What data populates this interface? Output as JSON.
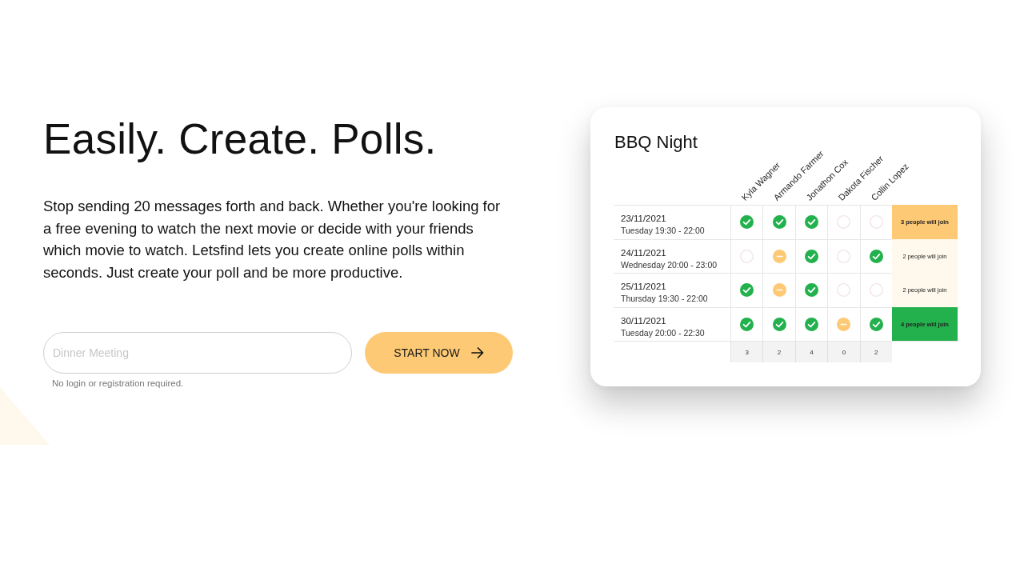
{
  "hero": {
    "title": "Easily. Create. Polls.",
    "description": "Stop sending 20 messages forth and back. Whether you're looking for a free evening to watch the next movie or decide with your friends which movie to watch. Letsfind lets you create online polls within seconds. Just create your poll and be more productive.",
    "input": {
      "placeholder": "Dinner Meeting"
    },
    "button": "START NOW",
    "hint": "No login or registration required."
  },
  "poll_card": {
    "title": "BBQ Night",
    "participants": [
      "Kyla Wagner",
      "Armando Farmer",
      "Jonathon Cox",
      "Dakota Fischer",
      "Collin Lopez"
    ],
    "rows": [
      {
        "date": "23/11/2021",
        "time": "Tuesday 19:30 - 22:00",
        "votes": [
          {
            "kind": "yes"
          },
          {
            "kind": "yes"
          },
          {
            "kind": "yes"
          },
          {
            "kind": "none"
          },
          {
            "kind": "none"
          }
        ],
        "result": "3 people will join",
        "color": "#fdc974",
        "emphasized": true
      },
      {
        "date": "24/11/2021",
        "time": "Wednesday 20:00 - 23:00",
        "votes": [
          {
            "kind": "none"
          },
          {
            "kind": "maybe"
          },
          {
            "kind": "yes"
          },
          {
            "kind": "none"
          },
          {
            "kind": "yes"
          }
        ],
        "result": "2 people will join",
        "color": "#fef9ec",
        "emphasized": false
      },
      {
        "date": "25/11/2021",
        "time": "Thursday 19:30 - 22:00",
        "votes": [
          {
            "kind": "yes"
          },
          {
            "kind": "maybe"
          },
          {
            "kind": "yes"
          },
          {
            "kind": "none"
          },
          {
            "kind": "none"
          }
        ],
        "result": "2 people will join",
        "color": "#fef9ec",
        "emphasized": false
      },
      {
        "date": "30/11/2021",
        "time": "Tuesday 20:00 - 22:30",
        "votes": [
          {
            "kind": "yes"
          },
          {
            "kind": "yes"
          },
          {
            "kind": "yes"
          },
          {
            "kind": "maybe"
          },
          {
            "kind": "yes"
          }
        ],
        "result": "4 people will join",
        "color": "#22b14c",
        "emphasized": true
      }
    ],
    "totals": [
      "3",
      "2",
      "4",
      "0",
      "2"
    ]
  }
}
